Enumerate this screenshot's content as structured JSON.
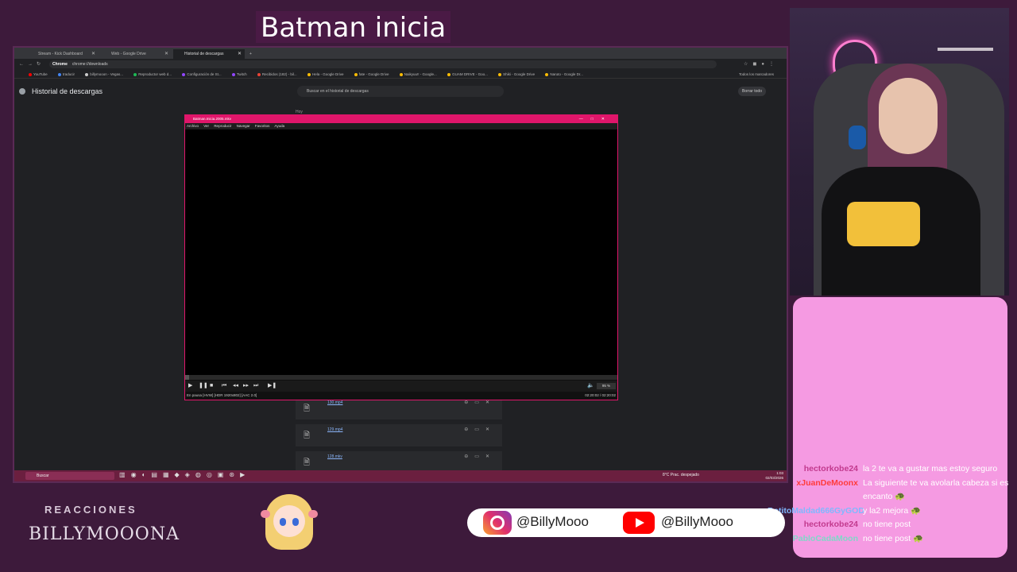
{
  "stream": {
    "title": "Batman inicia",
    "reacciones": "REACCIONES",
    "brand": "BILLYMOOONA"
  },
  "browser": {
    "tabs": [
      "Stream - Kick Dashboard",
      "Web - Google Drive",
      "Historial de descargas"
    ],
    "address_chip": "Chrome",
    "address": "chrome://downloads",
    "bookmarks": [
      "YouTube",
      "traducir",
      "billymooon - Vegas...",
      "Reproductor web d...",
      "Configuración de St...",
      "Twitch",
      "Recibidos (182) - bil...",
      "Hela - Google Drive",
      "fate - Google Drive",
      "Naikyuu!! - Google...",
      "GUAM DRIVE - Goo...",
      "Shiki - Google Drive",
      "Naruto - Google Dr..."
    ],
    "bookmarks_all": "Todos los marcadores"
  },
  "downloads": {
    "title": "Historial de descargas",
    "search_placeholder": "Buscar en el historial de descargas",
    "clear_all": "Borrar todo",
    "today": "Hoy",
    "items": [
      {
        "name": "130.mp4"
      },
      {
        "name": "129.mp4"
      },
      {
        "name": "128.mkv"
      }
    ]
  },
  "player": {
    "title": "Batman.Inicia.2005.mkv",
    "menu": [
      "Archivo",
      "Ver",
      "Reproducir",
      "Navegar",
      "Favoritos",
      "Ayuda"
    ],
    "status": "En pausa [HVW]    [HDR 1920x802]    [AAC 2.0]",
    "time": "02:20:02 / 02:20:02",
    "volume": "95 %",
    "seek_fraction": 0.01
  },
  "taskbar": {
    "search": "Buscar",
    "weather": "8°C  Prac. despejado",
    "time": "1:03",
    "date": "02/03/2026"
  },
  "chat": [
    {
      "user": "hectorkobe24",
      "color": "#c23a8e",
      "msg": "la 2 te va a gustar mas estoy seguro"
    },
    {
      "user": "xJuanDeMoonx",
      "color": "#ff3b3b",
      "msg": "La siguiente te va avolarla cabeza si es encanto 🐢"
    },
    {
      "user": "BotitoMaldad666GyGOD",
      "color": "#7fb8ff",
      "msg": "y la2 mejora 🐢"
    },
    {
      "user": "hectorkobe24",
      "color": "#c23a8e",
      "msg": "no tiene post"
    },
    {
      "user": "PabloCadaMoon",
      "color": "#7fd8c8",
      "msg": "no tiene post 🐢"
    }
  ],
  "socials": {
    "instagram": "@BillyMooo",
    "youtube": "@BillyMooo"
  }
}
